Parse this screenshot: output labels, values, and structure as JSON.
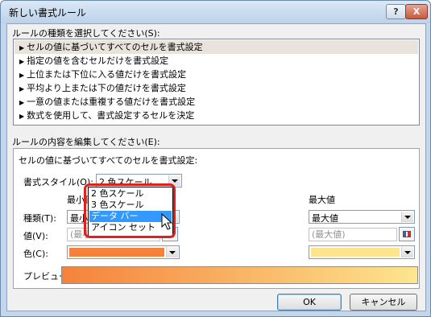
{
  "window": {
    "title": "新しい書式ルール",
    "help_label": "?",
    "close_label": "X"
  },
  "rule_types": {
    "label": "ルールの種類を選択してください(S):",
    "items": [
      "セルの値に基づいてすべてのセルを書式設定",
      "指定の値を含むセルだけを書式設定",
      "上位または下位に入る値だけを書式設定",
      "平均より上または下の値だけを書式設定",
      "一意の値または重複する値だけを書式設定",
      "数式を使用して、書式設定するセルを決定"
    ],
    "selected_index": 0
  },
  "rule_edit": {
    "label": "ルールの内容を編集してください(E):",
    "description": "セルの値に基づいてすべてのセルを書式設定:",
    "format_style_label": "書式スタイル(O):",
    "format_style_value": "2 色スケール",
    "min_header": "最小値",
    "max_header": "最大値",
    "type_label": "種類(T):",
    "min_type_value": "最小値",
    "max_type_value": "最大値",
    "value_label": "値(V):",
    "min_value_placeholder": "(最小値)",
    "max_value_placeholder": "(最大値)",
    "color_label": "色(C):",
    "min_color": "#f5823a",
    "max_color": "#fde58f",
    "preview_label": "プレビュー:"
  },
  "format_style_dropdown": {
    "options": [
      "2 色スケール",
      "3 色スケール",
      "データ バー",
      "アイコン セット"
    ],
    "highlighted_index": 2
  },
  "buttons": {
    "ok": "OK",
    "cancel": "キャンセル"
  },
  "colors": {
    "highlight_ring": "#e0201c",
    "selection": "#3399ff"
  }
}
